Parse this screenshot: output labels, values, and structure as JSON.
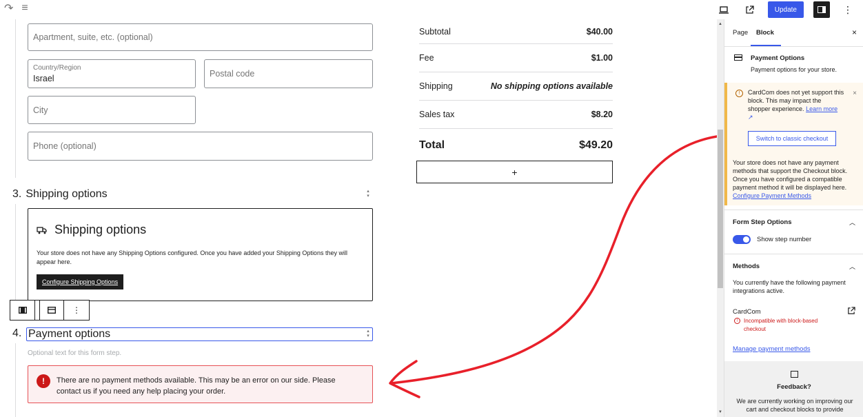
{
  "topbar": {
    "redo_icon": "↷",
    "list_icon": "≡",
    "update_label": "Update"
  },
  "address": {
    "apartment_placeholder": "Apartment, suite, etc. (optional)",
    "country_label": "Country/Region",
    "country_value": "Israel",
    "postal_placeholder": "Postal code",
    "city_placeholder": "City",
    "phone_placeholder": "Phone (optional)"
  },
  "shipping_step": {
    "number": "3.",
    "title": "Shipping options",
    "box_title": "Shipping options",
    "box_text": "Your store does not have any Shipping Options configured. Once you have added your Shipping Options they will appear here.",
    "box_button": "Configure Shipping Options"
  },
  "payment_step": {
    "number": "4.",
    "title": "Payment options",
    "optional_text": "Optional text for this form step.",
    "error_icon": "!",
    "error_text": "There are no payment methods available. This may be an error on our side. Please contact us if you need any help placing your order."
  },
  "totals": {
    "rows": [
      {
        "label": "Subtotal",
        "value": "$40.00"
      },
      {
        "label": "Fee",
        "value": "$1.00"
      },
      {
        "label": "Shipping",
        "value": "No shipping options available"
      },
      {
        "label": "Sales tax",
        "value": "$8.20"
      }
    ],
    "total_label": "Total",
    "total_value": "$49.20",
    "add_label": "+"
  },
  "sidebar": {
    "tab_page": "Page",
    "tab_block": "Block",
    "close": "×",
    "block_title": "Payment Options",
    "block_desc": "Payment options for your store.",
    "warning_text": "CardCom does not yet support this block. This may impact the shopper experience.",
    "warning_link": "Learn more",
    "warning_ext": "↗",
    "switch_button": "Switch to classic checkout",
    "no_methods_text": "Your store does not have any payment methods that support the Checkout block. Once you have configured a compatible payment method it will be displayed here.",
    "configure_link": "Configure Payment Methods",
    "form_step_title": "Form Step Options",
    "show_step_label": "Show step number",
    "methods_title": "Methods",
    "methods_text": "You currently have the following payment integrations active.",
    "method_name": "CardCom",
    "method_error": "Incompatible with block-based checkout",
    "manage_link": "Manage payment methods",
    "feedback_title": "Feedback?",
    "feedback_text": "We are currently working on improving our cart and checkout blocks to provide"
  },
  "annotation_color": "#e8202a"
}
